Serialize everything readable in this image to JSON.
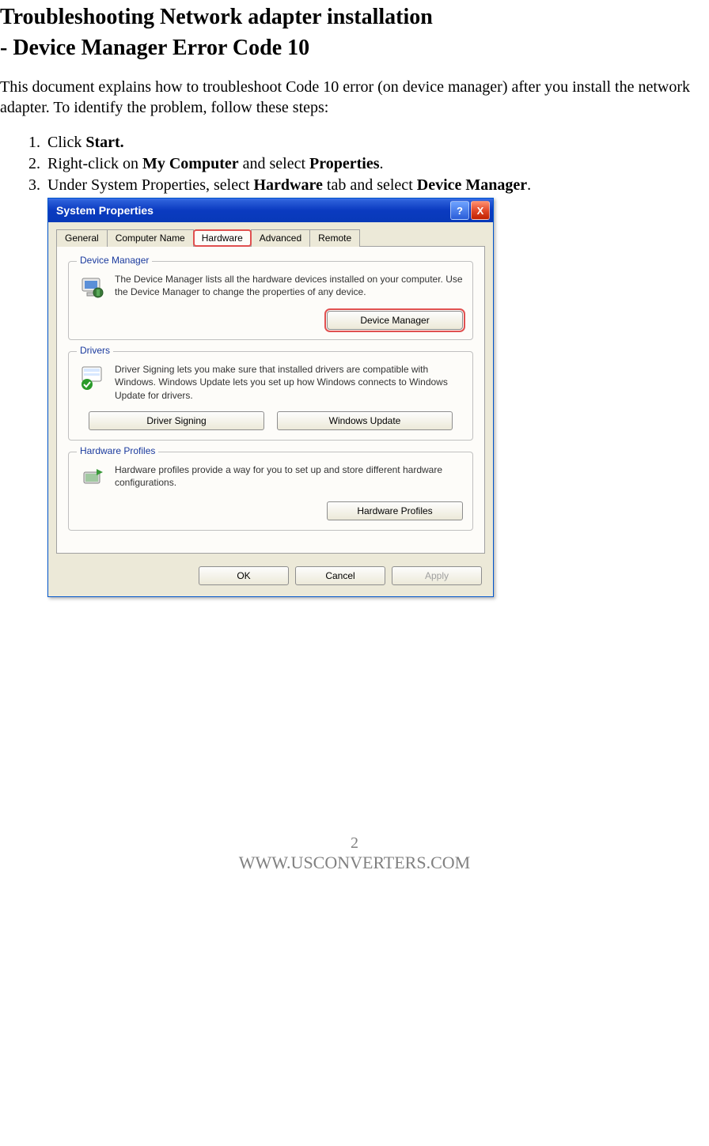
{
  "heading_line1": "Troubleshooting Network adapter installation",
  "heading_line2": "- Device Manager Error Code 10",
  "intro": "This document explains how to troubleshoot Code 10 error (on device manager) after you install the network adapter. To identify the problem, follow these steps:",
  "steps": {
    "s1_a": "Click ",
    "s1_b": "Start.",
    "s2_a": "Right-click on ",
    "s2_b": "My Computer",
    "s2_c": " and select ",
    "s2_d": "Properties",
    "s2_e": ".",
    "s3_a": "Under System Properties, select ",
    "s3_b": "Hardware",
    "s3_c": " tab and select ",
    "s3_d": "Device Manager",
    "s3_e": "."
  },
  "dialog": {
    "title": "System Properties",
    "help_btn": "?",
    "close_btn": "X",
    "tabs": {
      "general": "General",
      "computer_name": "Computer Name",
      "hardware": "Hardware",
      "advanced": "Advanced",
      "remote": "Remote"
    },
    "groups": {
      "device_manager": {
        "title": "Device Manager",
        "text": "The Device Manager lists all the hardware devices installed on your computer. Use the Device Manager to change the properties of any device.",
        "button": "Device Manager"
      },
      "drivers": {
        "title": "Drivers",
        "text": "Driver Signing lets you make sure that installed drivers are compatible with Windows. Windows Update lets you set up how Windows connects to Windows Update for drivers.",
        "button1": "Driver Signing",
        "button2": "Windows Update"
      },
      "hardware_profiles": {
        "title": "Hardware Profiles",
        "text": "Hardware profiles provide a way for you to set up and store different hardware configurations.",
        "button": "Hardware Profiles"
      }
    },
    "footer": {
      "ok": "OK",
      "cancel": "Cancel",
      "apply": "Apply"
    }
  },
  "page_footer": {
    "page_num": "2",
    "url": "WWW.USCONVERTERS.COM"
  }
}
